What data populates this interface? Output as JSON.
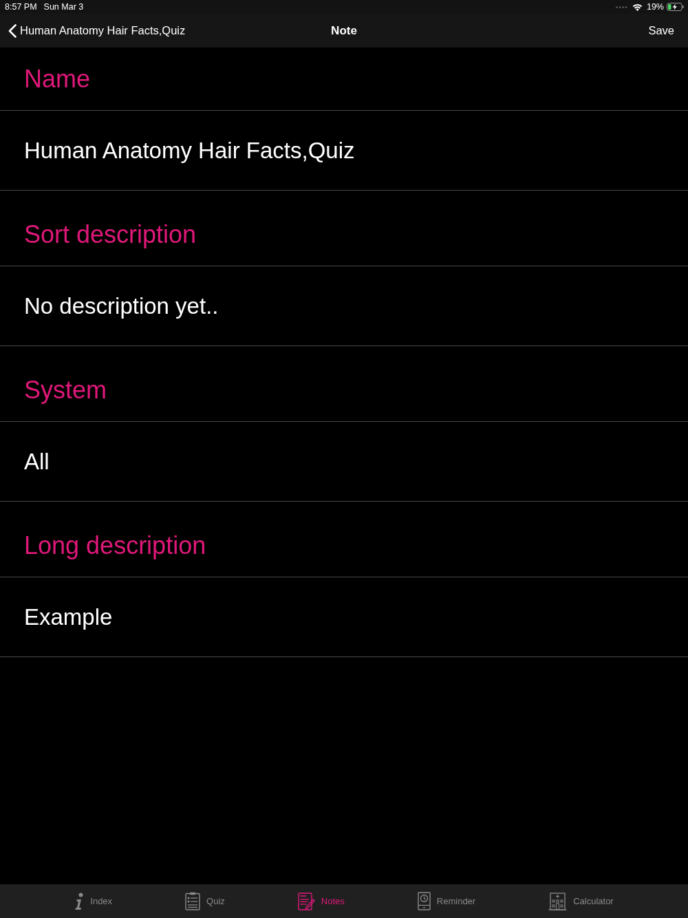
{
  "status_bar": {
    "time": "8:57 PM",
    "date": "Sun Mar 3",
    "battery": "19%"
  },
  "nav_bar": {
    "back_label": "Human Anatomy Hair Facts,Quiz",
    "title": "Note",
    "action": "Save"
  },
  "fields": [
    {
      "label": "Name",
      "value": "Human Anatomy Hair Facts,Quiz"
    },
    {
      "label": "Sort description",
      "value": "No description yet.."
    },
    {
      "label": "System",
      "value": "All"
    },
    {
      "label": "Long description",
      "value": "Example"
    }
  ],
  "tab_bar": [
    {
      "label": "Index",
      "selected": false
    },
    {
      "label": "Quiz",
      "selected": false
    },
    {
      "label": "Notes",
      "selected": true
    },
    {
      "label": "Reminder",
      "selected": false
    },
    {
      "label": "Calculator",
      "selected": false
    }
  ]
}
